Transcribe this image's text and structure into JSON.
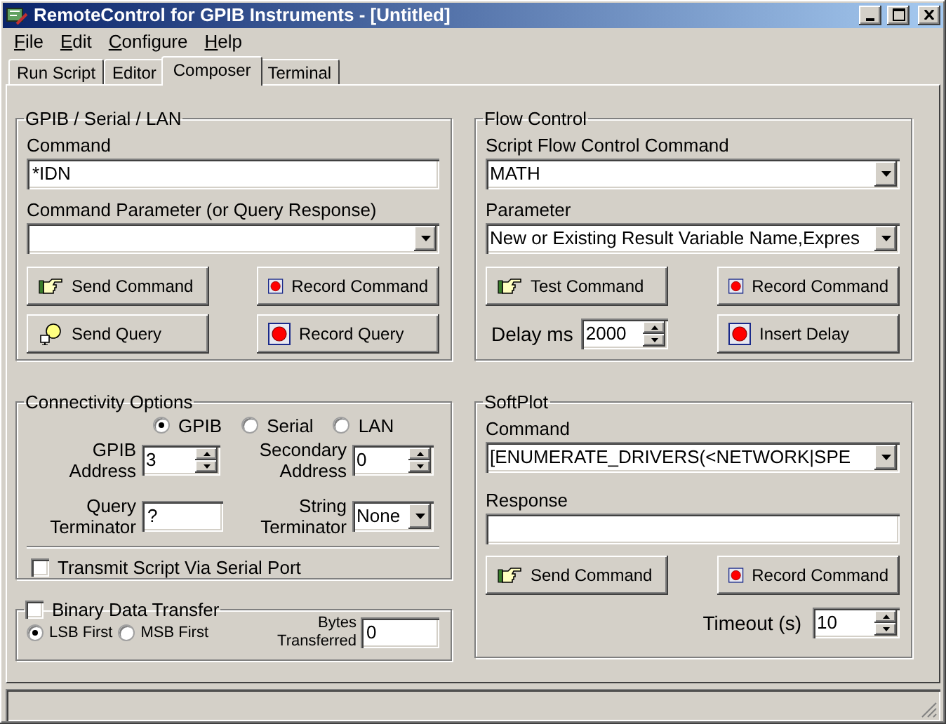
{
  "window": {
    "title": "RemoteControl for GPIB Instruments - [Untitled]"
  },
  "menu": [
    "File",
    "Edit",
    "Configure",
    "Help"
  ],
  "tabs": [
    {
      "label": "Run Script",
      "selected": false
    },
    {
      "label": "Editor",
      "selected": false
    },
    {
      "label": "Composer",
      "selected": true
    },
    {
      "label": "Terminal",
      "selected": false
    }
  ],
  "gpib": {
    "title": "GPIB / Serial / LAN",
    "command_label": "Command",
    "command_value": "*IDN",
    "parameter_label": "Command Parameter (or Query Response)",
    "buttons": [
      {
        "label": "Send Command",
        "kind": "hand"
      },
      {
        "label": "Record Command",
        "kind": "record"
      },
      {
        "label": "Send Query",
        "kind": "query"
      },
      {
        "label": "Record Query",
        "kind": "record"
      }
    ]
  },
  "flow": {
    "title": "Flow Control",
    "command_label": "Script Flow Control Command",
    "command_value": "MATH",
    "parameter_label": "Parameter",
    "parameter_value": "New or Existing Result Variable Name,Expres",
    "buttons": [
      {
        "label": "Test Command",
        "kind": "hand"
      },
      {
        "label": "Record Command",
        "kind": "record"
      }
    ],
    "delay_label": "Delay ms",
    "delay_value": "2000",
    "delay_button": {
      "label": "Insert Delay",
      "kind": "record"
    }
  },
  "connectivity": {
    "title": "Connectivity Options",
    "interfaces": [
      {
        "label": "GPIB",
        "selected": true
      },
      {
        "label": "Serial",
        "selected": false
      },
      {
        "label": "LAN",
        "selected": false
      }
    ],
    "gpib_address_label": "GPIB Address",
    "gpib_address_value": "3",
    "secondary_address_label": "Secondary Address",
    "secondary_address_value": "0",
    "query_terminator_label": "Query Terminator",
    "query_terminator_value": "?",
    "string_terminator_label": "String Terminator",
    "string_terminator_value": "None",
    "transmit": {
      "label": "Transmit Script Via Serial Port",
      "checked": false
    }
  },
  "binary": {
    "label": "Binary Data Transfer",
    "checked": false,
    "byte_order": [
      {
        "label": "LSB First",
        "selected": true
      },
      {
        "label": "MSB First",
        "selected": false
      }
    ],
    "bytes_label": "Bytes Transferred",
    "bytes_value": "0"
  },
  "softplot": {
    "title": "SoftPlot",
    "command_label": "Command",
    "command_value": "[ENUMERATE_DRIVERS(<NETWORK|SPE",
    "response_label": "Response",
    "buttons": [
      {
        "label": "Send Command",
        "kind": "hand"
      },
      {
        "label": "Record Command",
        "kind": "record"
      }
    ],
    "timeout_label": "Timeout (s)",
    "timeout_value": "10"
  }
}
